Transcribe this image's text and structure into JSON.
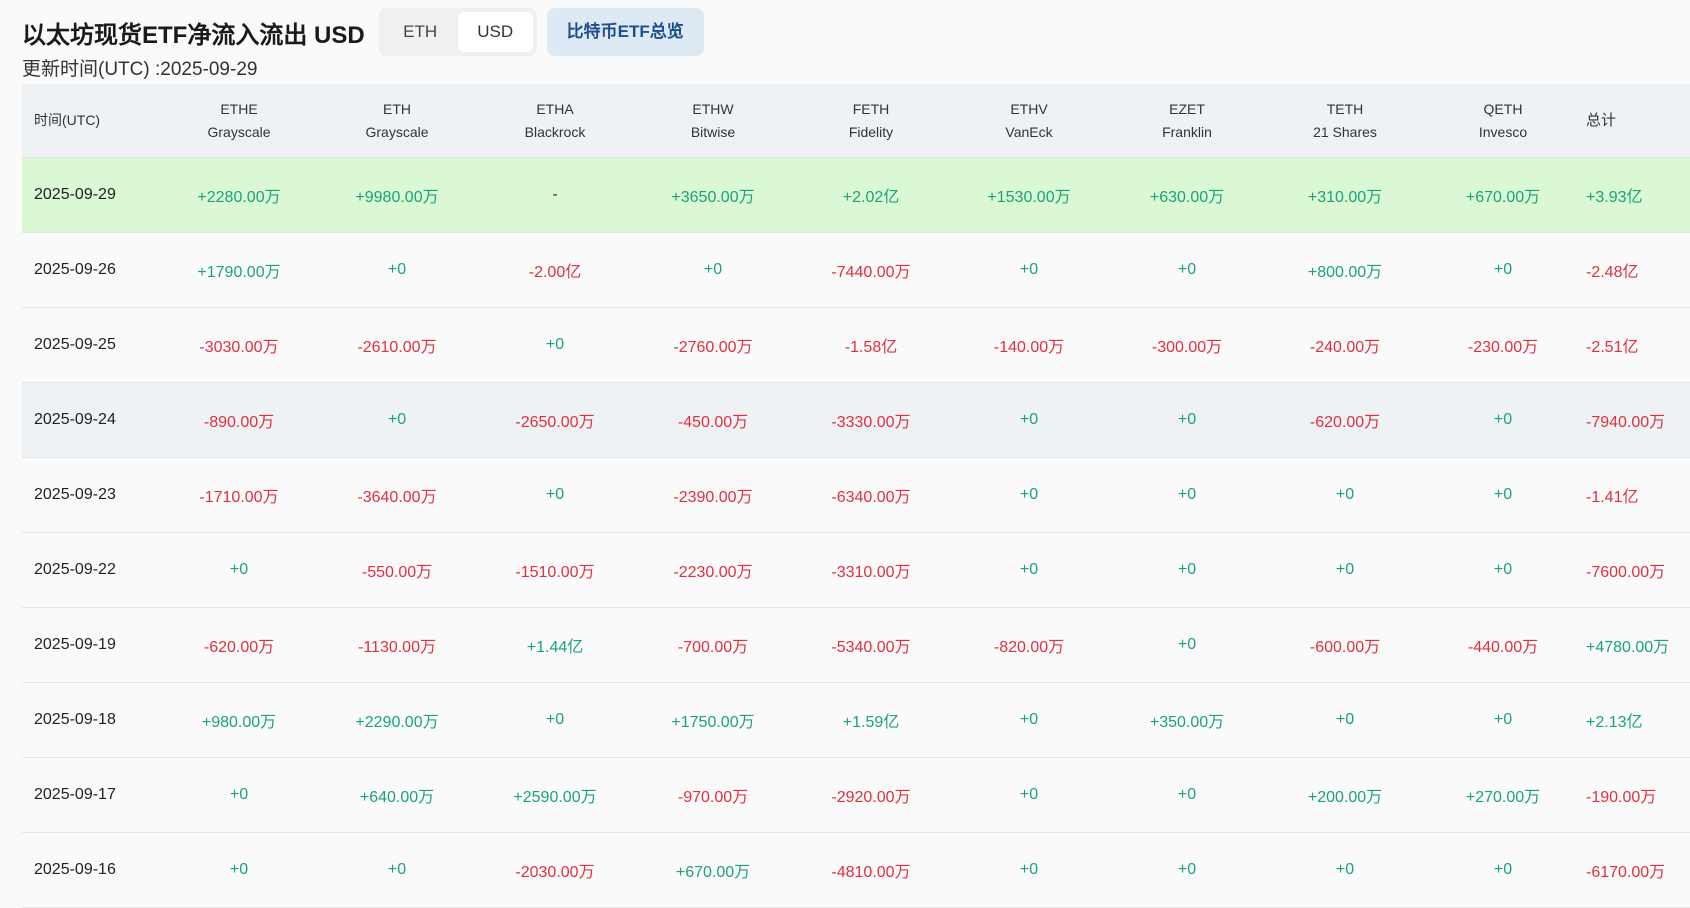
{
  "title": "以太坊现货ETF净流入流出 USD",
  "toggle": {
    "eth": "ETH",
    "usd": "USD",
    "active": "USD"
  },
  "btc_button": "比特币ETF总览",
  "updated": "更新时间(UTC) :2025-09-29",
  "colors": {
    "positive": "#1aa37a",
    "negative": "#e0303f",
    "highlight_row": "#d9f8d3",
    "header_bg": "#eef2f5"
  },
  "table": {
    "date_header": "时间(UTC)",
    "total_header": "总计",
    "columns": [
      {
        "ticker": "ETHE",
        "issuer": "Grayscale"
      },
      {
        "ticker": "ETH",
        "issuer": "Grayscale"
      },
      {
        "ticker": "ETHA",
        "issuer": "Blackrock"
      },
      {
        "ticker": "ETHW",
        "issuer": "Bitwise"
      },
      {
        "ticker": "FETH",
        "issuer": "Fidelity"
      },
      {
        "ticker": "ETHV",
        "issuer": "VanEck"
      },
      {
        "ticker": "EZET",
        "issuer": "Franklin"
      },
      {
        "ticker": "TETH",
        "issuer": "21 Shares"
      },
      {
        "ticker": "QETH",
        "issuer": "Invesco"
      }
    ],
    "rows": [
      {
        "date": "2025-09-29",
        "values": [
          "+2280.00万",
          "+9980.00万",
          "-",
          "+3650.00万",
          "+2.02亿",
          "+1530.00万",
          "+630.00万",
          "+310.00万",
          "+670.00万"
        ],
        "total": "+3.93亿"
      },
      {
        "date": "2025-09-26",
        "values": [
          "+1790.00万",
          "+0",
          "-2.00亿",
          "+0",
          "-7440.00万",
          "+0",
          "+0",
          "+800.00万",
          "+0"
        ],
        "total": "-2.48亿"
      },
      {
        "date": "2025-09-25",
        "values": [
          "-3030.00万",
          "-2610.00万",
          "+0",
          "-2760.00万",
          "-1.58亿",
          "-140.00万",
          "-300.00万",
          "-240.00万",
          "-230.00万"
        ],
        "total": "-2.51亿"
      },
      {
        "date": "2025-09-24",
        "values": [
          "-890.00万",
          "+0",
          "-2650.00万",
          "-450.00万",
          "-3330.00万",
          "+0",
          "+0",
          "-620.00万",
          "+0"
        ],
        "total": "-7940.00万"
      },
      {
        "date": "2025-09-23",
        "values": [
          "-1710.00万",
          "-3640.00万",
          "+0",
          "-2390.00万",
          "-6340.00万",
          "+0",
          "+0",
          "+0",
          "+0"
        ],
        "total": "-1.41亿"
      },
      {
        "date": "2025-09-22",
        "values": [
          "+0",
          "-550.00万",
          "-1510.00万",
          "-2230.00万",
          "-3310.00万",
          "+0",
          "+0",
          "+0",
          "+0"
        ],
        "total": "-7600.00万"
      },
      {
        "date": "2025-09-19",
        "values": [
          "-620.00万",
          "-1130.00万",
          "+1.44亿",
          "-700.00万",
          "-5340.00万",
          "-820.00万",
          "+0",
          "-600.00万",
          "-440.00万"
        ],
        "total": "+4780.00万"
      },
      {
        "date": "2025-09-18",
        "values": [
          "+980.00万",
          "+2290.00万",
          "+0",
          "+1750.00万",
          "+1.59亿",
          "+0",
          "+350.00万",
          "+0",
          "+0"
        ],
        "total": "+2.13亿"
      },
      {
        "date": "2025-09-17",
        "values": [
          "+0",
          "+640.00万",
          "+2590.00万",
          "-970.00万",
          "-2920.00万",
          "+0",
          "+0",
          "+200.00万",
          "+270.00万"
        ],
        "total": "-190.00万"
      },
      {
        "date": "2025-09-16",
        "values": [
          "+0",
          "+0",
          "-2030.00万",
          "+670.00万",
          "-4810.00万",
          "+0",
          "+0",
          "+0",
          "+0"
        ],
        "total": "-6170.00万"
      }
    ]
  }
}
